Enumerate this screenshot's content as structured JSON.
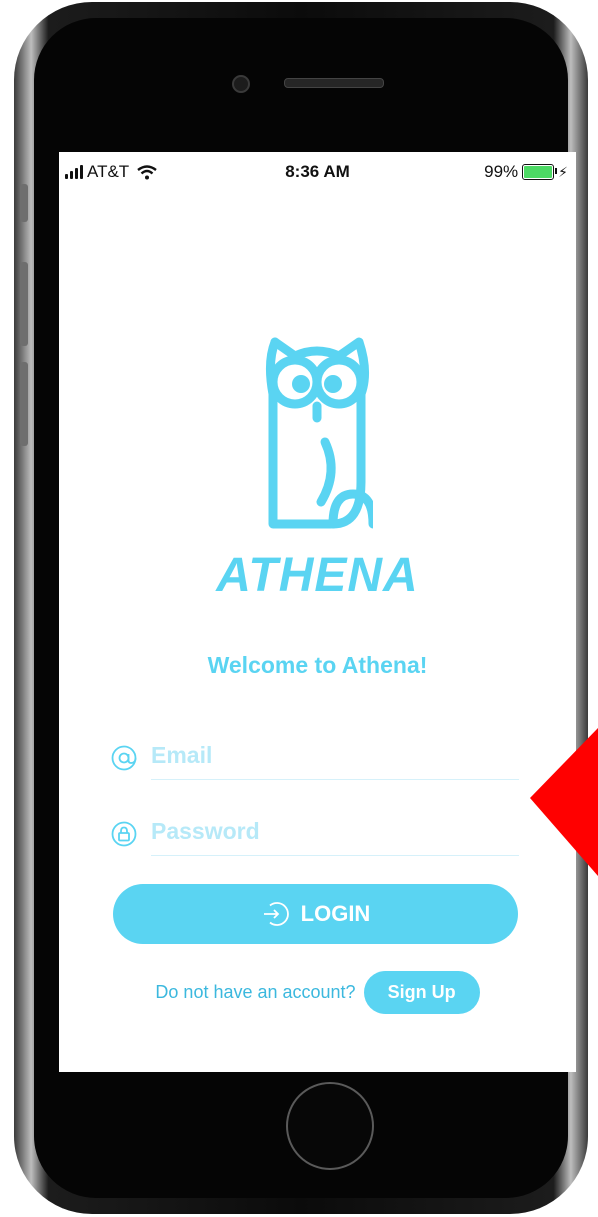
{
  "status_bar": {
    "carrier": "AT&T",
    "time": "8:36 AM",
    "battery": "99%"
  },
  "app": {
    "brand": "ATHENA",
    "welcome": "Welcome to Athena!"
  },
  "form": {
    "email_placeholder": "Email",
    "password_placeholder": "Password",
    "login_label": "LOGIN",
    "signup_prompt": "Do not have an account?",
    "signup_label": "Sign Up"
  },
  "colors": {
    "accent": "#5ad4f2",
    "placeholder": "#b6e9f8",
    "annotation_arrow": "#ff0000"
  },
  "icons": [
    "at-sign-icon",
    "lock-icon",
    "login-icon",
    "owl-logo",
    "wifi-icon",
    "battery-icon"
  ]
}
